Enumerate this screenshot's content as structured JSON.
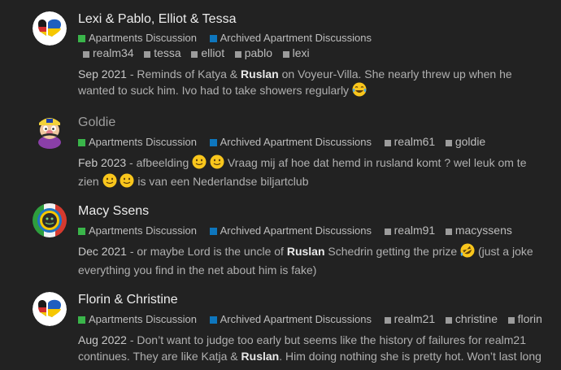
{
  "colors": {
    "background": "#222222",
    "title_read": "#ececec",
    "title_visited": "#9e9e9e",
    "category_green": "#3ab54a",
    "category_blue": "#0e76bd",
    "tag_square": "#9c9c9c"
  },
  "posts": [
    {
      "title": "Lexi & Pablo, Elliot & Tessa",
      "title_color": "#ececec",
      "avatar_icon": "german-ukrainian-flag-heart-icon",
      "categories": [
        "Apartments Discussion",
        "Archived Apartment Discussions"
      ],
      "tags": [
        "realm34",
        "tessa",
        "elliot",
        "pablo",
        "lexi"
      ],
      "date": "Sep 2021",
      "dash": " - ",
      "excerpt_parts": [
        "Reminds of Katya & ",
        "Ruslan",
        " on Voyeur-Villa. She nearly threw up when he wanted to suck him. Ivo had to take showers regularly "
      ],
      "excerpt_emojis": [
        "laughing-tears-emoji"
      ]
    },
    {
      "title": "Goldie",
      "title_color": "#9e9e9e",
      "avatar_icon": "cartoon-character-icon",
      "categories": [
        "Apartments Discussion",
        "Archived Apartment Discussions"
      ],
      "tags": [
        "realm61",
        "goldie"
      ],
      "date": "Feb 2023",
      "dash": " - ",
      "excerpt_parts": [
        "afbeelding ",
        " Vraag mij af hoe dat hemd in rusland komt ? wel leuk om te zien ",
        " is van een Nederlandse biljartclub"
      ],
      "excerpt_emojis": [
        "slight-smile-emoji",
        "slight-smile-emoji"
      ]
    },
    {
      "title": "Macy Ssens",
      "title_color": "#ececec",
      "avatar_icon": "globe-avatar-icon",
      "categories": [
        "Apartments Discussion",
        "Archived Apartment Discussions"
      ],
      "tags": [
        "realm91",
        "macyssens"
      ],
      "date": "Dec 2021",
      "dash": " - ",
      "excerpt_parts": [
        "or maybe Lord is the uncle of ",
        "Ruslan",
        " Schedrin getting the prize ",
        " (just a joke everything you find in the net about him is fake)"
      ],
      "excerpt_emojis": [
        "rolling-laughing-emoji"
      ]
    },
    {
      "title": "Florin & Christine",
      "title_color": "#ececec",
      "avatar_icon": "german-ukrainian-flag-heart-icon",
      "categories": [
        "Apartments Discussion",
        "Archived Apartment Discussions"
      ],
      "tags": [
        "realm21",
        "christine",
        "florin"
      ],
      "date": "Aug 2022",
      "dash": " - ",
      "excerpt_parts": [
        "Don’t want to judge too early but seems like the history of failures for realm21 continues. They are like Katja & ",
        "Ruslan",
        ". Him doing nothing she is pretty hot. Won’t last long"
      ],
      "excerpt_emojis": []
    }
  ]
}
